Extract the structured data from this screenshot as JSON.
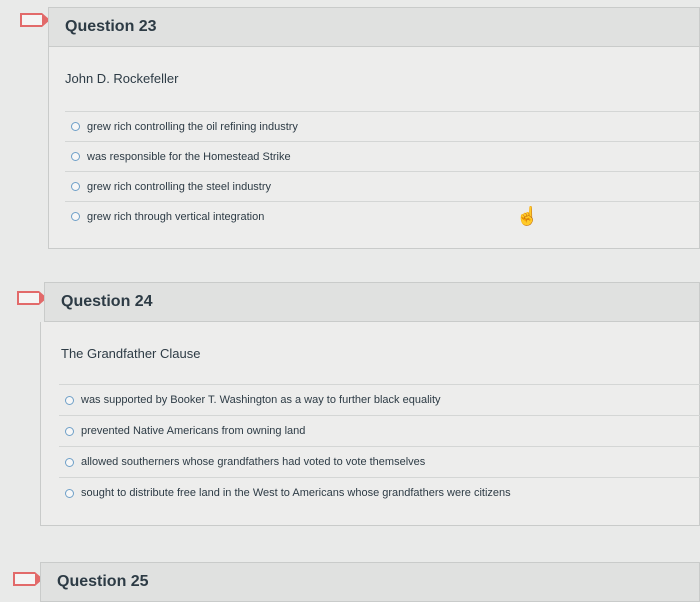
{
  "questions": [
    {
      "title": "Question 23",
      "prompt": "John D. Rockefeller",
      "answers": [
        "grew rich controlling the oil refining industry",
        "was responsible for the Homestead Strike",
        "grew rich controlling the steel industry",
        "grew rich through vertical integration"
      ]
    },
    {
      "title": "Question 24",
      "prompt": "The Grandfather Clause",
      "answers": [
        "was supported by Booker T. Washington as a way to further black equality",
        "prevented Native Americans from owning land",
        "allowed southerners whose grandfathers had voted to vote themselves",
        "sought to distribute free land in the West to Americans whose grandfathers were citizens"
      ]
    },
    {
      "title": "Question 25"
    }
  ],
  "icons": {
    "flag": "flag-icon",
    "cursor": "hand-pointer-icon"
  },
  "colors": {
    "flag": "#e26a6a",
    "radio": "#6fa0c8"
  }
}
